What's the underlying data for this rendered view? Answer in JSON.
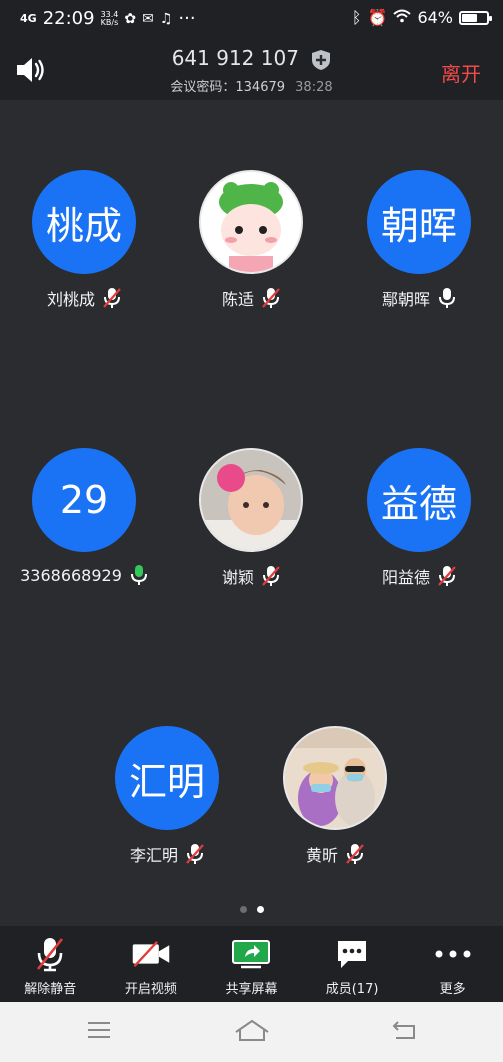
{
  "status_bar": {
    "network": "4G",
    "time": "22:09",
    "net_speed_value": "33.4",
    "net_speed_unit": "KB/s",
    "overflow": "···",
    "battery": "64%",
    "battery_level": 0.64
  },
  "header": {
    "meeting_id": "641 912 107",
    "password_label": "会议密码：134679",
    "elapsed": "38:28",
    "leave_label": "离开"
  },
  "participants": [
    {
      "avatar_text": "桃成",
      "name": "刘桃成",
      "mic": "muted"
    },
    {
      "avatar_text": "",
      "name": "陈适",
      "mic": "muted"
    },
    {
      "avatar_text": "朝晖",
      "name": "鄢朝晖",
      "mic": "on"
    },
    {
      "avatar_text": "29",
      "name": "3368668929",
      "mic": "active"
    },
    {
      "avatar_text": "",
      "name": "谢颖",
      "mic": "muted"
    },
    {
      "avatar_text": "益德",
      "name": "阳益德",
      "mic": "muted"
    },
    {
      "avatar_text": "汇明",
      "name": "李汇明",
      "mic": "muted"
    },
    {
      "avatar_text": "",
      "name": "黄昕",
      "mic": "muted"
    }
  ],
  "pager": {
    "pages": 2,
    "current": 2
  },
  "toolbar": {
    "unmute_label": "解除静音",
    "video_label": "开启视频",
    "share_label": "共享屏幕",
    "members_label": "成员(17)",
    "more_label": "更多"
  },
  "colors": {
    "accent_blue": "#1a73f5",
    "leave_red": "#f04a4a",
    "mic_green": "#34c759",
    "share_green": "#22a84a"
  }
}
